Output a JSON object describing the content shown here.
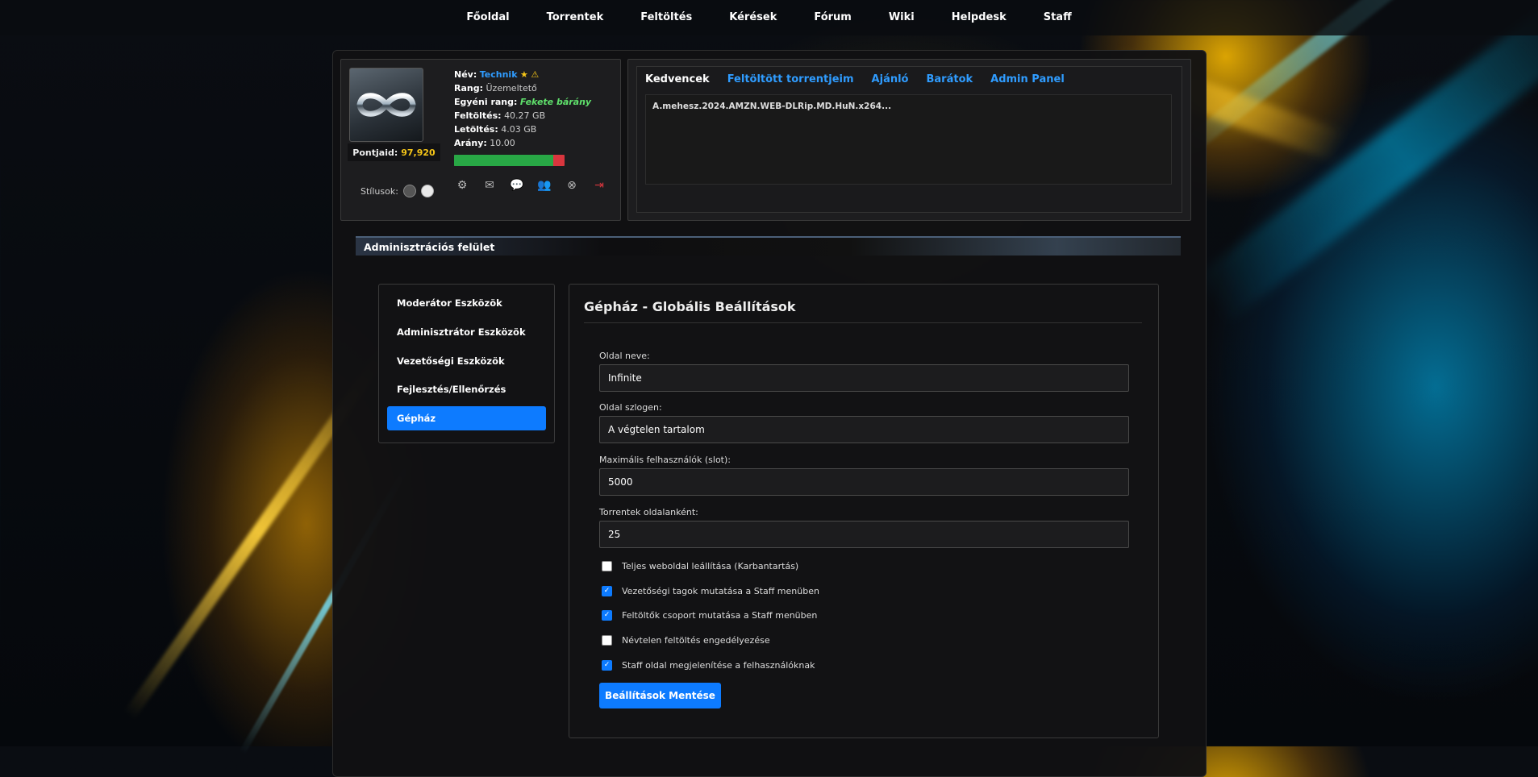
{
  "nav": [
    "Főoldal",
    "Torrentek",
    "Feltöltés",
    "Kérések",
    "Fórum",
    "Wiki",
    "Helpdesk",
    "Staff"
  ],
  "profile": {
    "points_label": "Pontjaid:",
    "points_value": "97,920",
    "styles_label": "Stílusok:",
    "name_label": "Név:",
    "name_value": "Technik",
    "rank_label": "Rang:",
    "rank_value": "Üzemeltető",
    "custom_rank_label": "Egyéni rang:",
    "custom_rank_value": "Fekete bárány",
    "upload_label": "Feltöltés:",
    "upload_value": "40.27 GB",
    "download_label": "Letöltés:",
    "download_value": "4.03 GB",
    "ratio_label": "Arány:",
    "ratio_value": "10.00",
    "ratio_bar_fill": 0.9,
    "icons": [
      "user-settings-icon",
      "mail-icon",
      "chat-icon",
      "friends-icon",
      "close-circle-icon",
      "logout-icon"
    ]
  },
  "tabs": {
    "items": [
      "Kedvencek",
      "Feltöltött torrentjeim",
      "Ajánló",
      "Barátok",
      "Admin Panel"
    ],
    "active_index": 0,
    "content": "A.mehesz.2024.AMZN.WEB-DLRip.MD.HuN.x264..."
  },
  "admin": {
    "header": "Adminisztrációs felület",
    "menu": [
      "Moderátor Eszközök",
      "Adminisztrátor Eszközök",
      "Vezetőségi Eszközök",
      "Fejlesztés/Ellenőrzés",
      "Gépház"
    ],
    "menu_active_index": 4,
    "title": "Gépház - Globális Beállítások",
    "fields": [
      {
        "label": "Oldal neve:",
        "value": "Infinite"
      },
      {
        "label": "Oldal szlogen:",
        "value": "A végtelen tartalom"
      },
      {
        "label": "Maximális felhasználók (slot):",
        "value": "5000"
      },
      {
        "label": "Torrentek oldalanként:",
        "value": "25"
      }
    ],
    "checkboxes": [
      {
        "label": "Teljes weboldal leállítása (Karbantartás)",
        "checked": false
      },
      {
        "label": "Vezetőségi tagok mutatása a Staff menüben",
        "checked": true
      },
      {
        "label": "Feltöltők csoport mutatása a Staff menüben",
        "checked": true
      },
      {
        "label": "Névtelen feltöltés engedélyezése",
        "checked": false
      },
      {
        "label": "Staff oldal megjelenítése a felhasználóknak",
        "checked": true
      }
    ],
    "save_label": "Beállítások Mentése"
  },
  "colors": {
    "accent": "#0d7bff",
    "link": "#2f9cff",
    "points": "#f5c518",
    "special_rank": "#5fe06b"
  }
}
